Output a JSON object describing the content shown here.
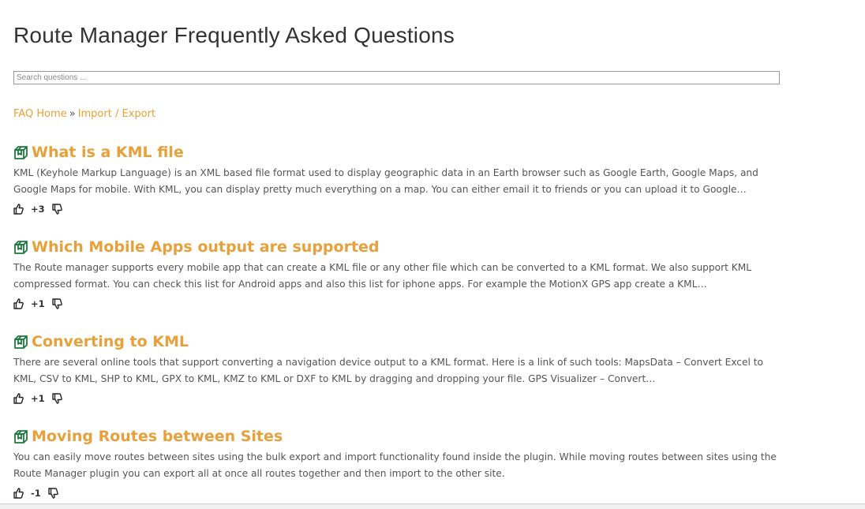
{
  "page": {
    "title": "Route Manager Frequently Asked Questions"
  },
  "search": {
    "placeholder": "Search questions ..."
  },
  "breadcrumb": {
    "home": "FAQ Home",
    "separator": "»",
    "current": "Import / Export"
  },
  "colors": {
    "accent": "#e8a03a",
    "icon_green": "#1e7a3c",
    "text": "#555555"
  },
  "faqs": [
    {
      "title": "What is a KML file",
      "excerpt": "KML (Keyhole Markup Language) is an XML based file format used to display geographic data in an Earth browser such as Google Earth, Google Maps, and Google Maps for mobile. With KML, you can display pretty much everything on a map. You can either email it to friends or you can upload it to Google…",
      "votes": "+3",
      "icon": "package-icon"
    },
    {
      "title": "Which Mobile Apps output are supported",
      "excerpt": "The Route manager supports every mobile app that can create a KML file or any other file which can be converted to a KML format. We also support KML compressed format. You can check this list for Android apps and also this list for iphone apps. For example the MotionX GPS app create a KML…",
      "votes": "+1",
      "icon": "package-icon"
    },
    {
      "title": "Converting to KML",
      "excerpt": "There are several online tools that support converting a navigation device output to a KML format. Here is a link of such tools: MapsData – Convert Excel to KML, CSV to KML, SHP to KML, GPX to KML, KMZ to KML or DXF to KML by dragging and dropping your file. GPS Visualizer – Convert…",
      "votes": "+1",
      "icon": "package-icon"
    },
    {
      "title": "Moving Routes between Sites",
      "excerpt": "You can easily move routes between sites using the bulk export and import functionality found inside the plugin. While moving routes between sites using the Route Manager plugin you can export all at once all routes together and then import to the other site.",
      "votes": "-1",
      "icon": "package-icon"
    }
  ]
}
